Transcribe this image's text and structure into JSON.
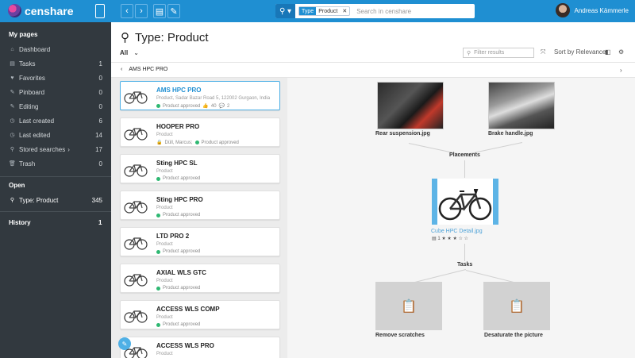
{
  "header": {
    "logo_text": "censhare",
    "search_chip_key": "Type",
    "search_chip_value": "Product",
    "search_chip_close": "✕",
    "search_placeholder": "Search in censhare",
    "user_name": "Andreas Kämmerle"
  },
  "sidebar": {
    "my_pages": "My pages",
    "items": [
      {
        "label": "Dashboard",
        "count": "",
        "icon": "⌂"
      },
      {
        "label": "Tasks",
        "count": "1",
        "icon": "▤"
      },
      {
        "label": "Favorites",
        "count": "0",
        "icon": "♥"
      },
      {
        "label": "Pinboard",
        "count": "0",
        "icon": "✎"
      },
      {
        "label": "Editing",
        "count": "0",
        "icon": "✎"
      },
      {
        "label": "Last created",
        "count": "6",
        "icon": "◷"
      },
      {
        "label": "Last edited",
        "count": "14",
        "icon": "◷"
      },
      {
        "label": "Stored searches",
        "count": "17",
        "icon": "⚲",
        "arrow": "›"
      },
      {
        "label": "Trash",
        "count": "0",
        "icon": "🗑"
      }
    ],
    "open": "Open",
    "open_item": {
      "label": "Type: Product",
      "count": "345"
    },
    "history": "History",
    "history_count": "1"
  },
  "main": {
    "title": "Type: Product",
    "filter_all": "All",
    "filter_placeholder": "Filter results",
    "sort_label": "Sort by Relevance",
    "breadcrumb": "AMS HPC PRO"
  },
  "products": [
    {
      "name": "AMS HPC PRO",
      "type": "Product, Sadar Bazar Road 5, 122002 Gurgaon, India",
      "status": "Product approved",
      "likes": "40",
      "dislikes": "2",
      "selected": true
    },
    {
      "name": "HOOPER PRO",
      "type": "Product",
      "owner": "Düll, Marcus;",
      "status": "Product approved"
    },
    {
      "name": "Sting HPC SL",
      "type": "Product",
      "status": "Product approved"
    },
    {
      "name": "Sting HPC PRO",
      "type": "Product",
      "status": "Product approved"
    },
    {
      "name": "LTD PRO 2",
      "type": "Product",
      "status": "Product approved"
    },
    {
      "name": "AXIAL WLS GTC",
      "type": "Product",
      "status": "Product approved"
    },
    {
      "name": "ACCESS WLS COMP",
      "type": "Product",
      "status": "Product approved"
    },
    {
      "name": "ACCESS WLS PRO",
      "type": "Product"
    }
  ],
  "detail": {
    "img1": "Rear suspension.jpg",
    "img2": "Brake handle.jpg",
    "placements": "Placements",
    "main_img": "Cube HPC Detail.jpg",
    "main_meta": "1",
    "rating_stars": "★ ★ ★ ☆ ☆",
    "tasks": "Tasks",
    "task1": "Remove scratches",
    "task2": "Desaturate the picture"
  }
}
